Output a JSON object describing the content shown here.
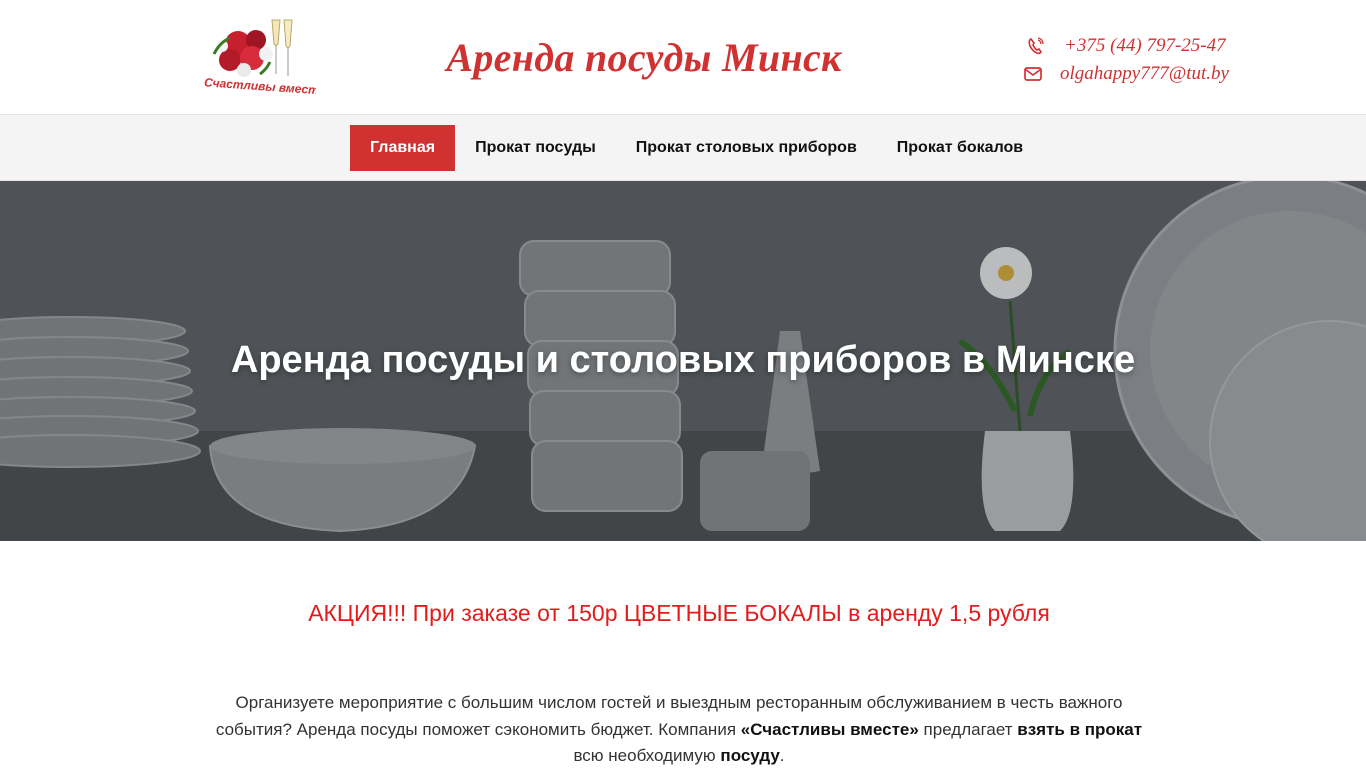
{
  "header": {
    "logo_text": "Счастливы вместе",
    "site_title": "Аренда посуды Минск",
    "phone": "+375 (44) 797-25-47",
    "email": "olgahappy777@tut.by"
  },
  "nav": {
    "items": [
      {
        "label": "Главная",
        "active": true
      },
      {
        "label": "Прокат посуды",
        "active": false
      },
      {
        "label": "Прокат столовых приборов",
        "active": false
      },
      {
        "label": "Прокат бокалов",
        "active": false
      }
    ]
  },
  "hero": {
    "title": "Аренда посуды и столовых приборов в Минске"
  },
  "promo": {
    "text": "АКЦИЯ!!! При заказе от 150р ЦВЕТНЫЕ БОКАЛЫ в аренду 1,5 рубля"
  },
  "intro": {
    "p1": "Организуете мероприятие с большим числом гостей и выездным ресторанным обслуживанием в честь важного события? Аренда посуды поможет сэкономить бюджет. Компания ",
    "company": "«Счастливы вместе»",
    "p2": " предлагает ",
    "bold1": "взять в прокат",
    "p3": " всю необходимую ",
    "bold2": "посуду",
    "p4": "."
  },
  "colors": {
    "accent": "#d03131",
    "promo": "#e31b1b",
    "nav_bg": "#f4f4f4"
  },
  "icons": {
    "phone": "phone-icon",
    "email": "envelope-icon"
  }
}
